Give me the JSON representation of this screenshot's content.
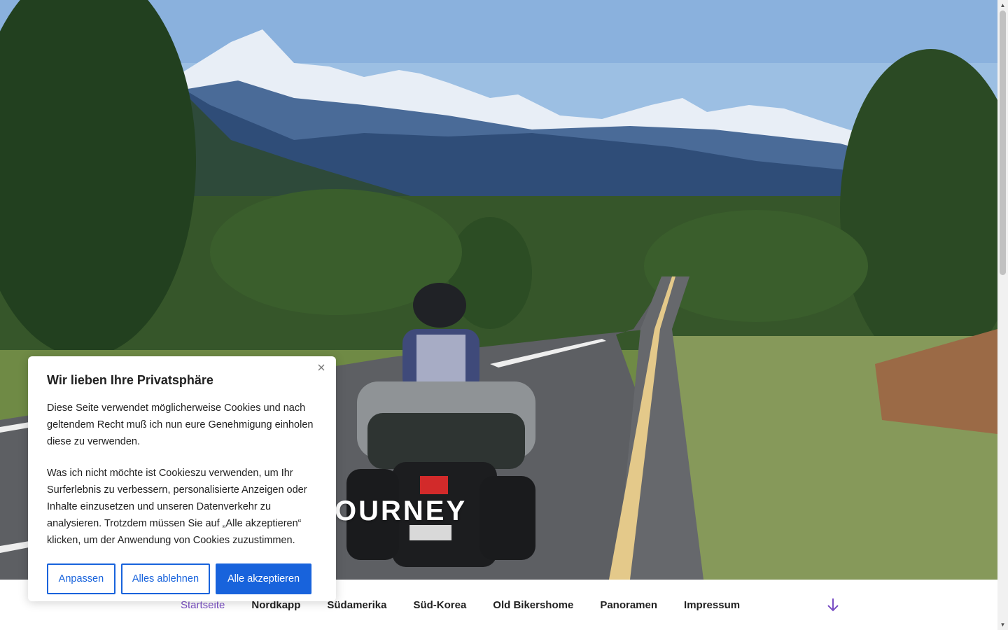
{
  "hero": {
    "title": "OURNEY"
  },
  "nav": {
    "items": [
      {
        "label": "Startseite",
        "active": true
      },
      {
        "label": "Nordkapp"
      },
      {
        "label": "Südamerika"
      },
      {
        "label": "Süd-Korea"
      },
      {
        "label": "Old Bikershome"
      },
      {
        "label": "Panoramen"
      },
      {
        "label": "Impressum"
      }
    ],
    "scroll_icon": "arrow-down-icon",
    "accent_color": "#7a4fc4"
  },
  "cookie": {
    "title": "Wir lieben Ihre Privatsphäre",
    "paragraph1": "Diese Seite verwendet möglicherweise Cookies und nach geltendem Recht muß ich nun eure Genehmigung einholen diese zu verwenden.",
    "paragraph2": "Was ich nicht möchte ist  Cookieszu verwenden, um Ihr Surferlebnis zu verbessern, personalisierte Anzeigen oder Inhalte einzusetzen und unseren Datenverkehr zu analysieren. Trotzdem müssen Sie auf „Alle akzeptieren“ klicken, um der Anwendung von Cookies zuzustimmen.",
    "btn_customize": "Anpassen",
    "btn_reject": "Alles ablehnen",
    "btn_accept": "Alle akzeptieren",
    "close_icon": "close-icon",
    "button_color": "#1863dc"
  }
}
